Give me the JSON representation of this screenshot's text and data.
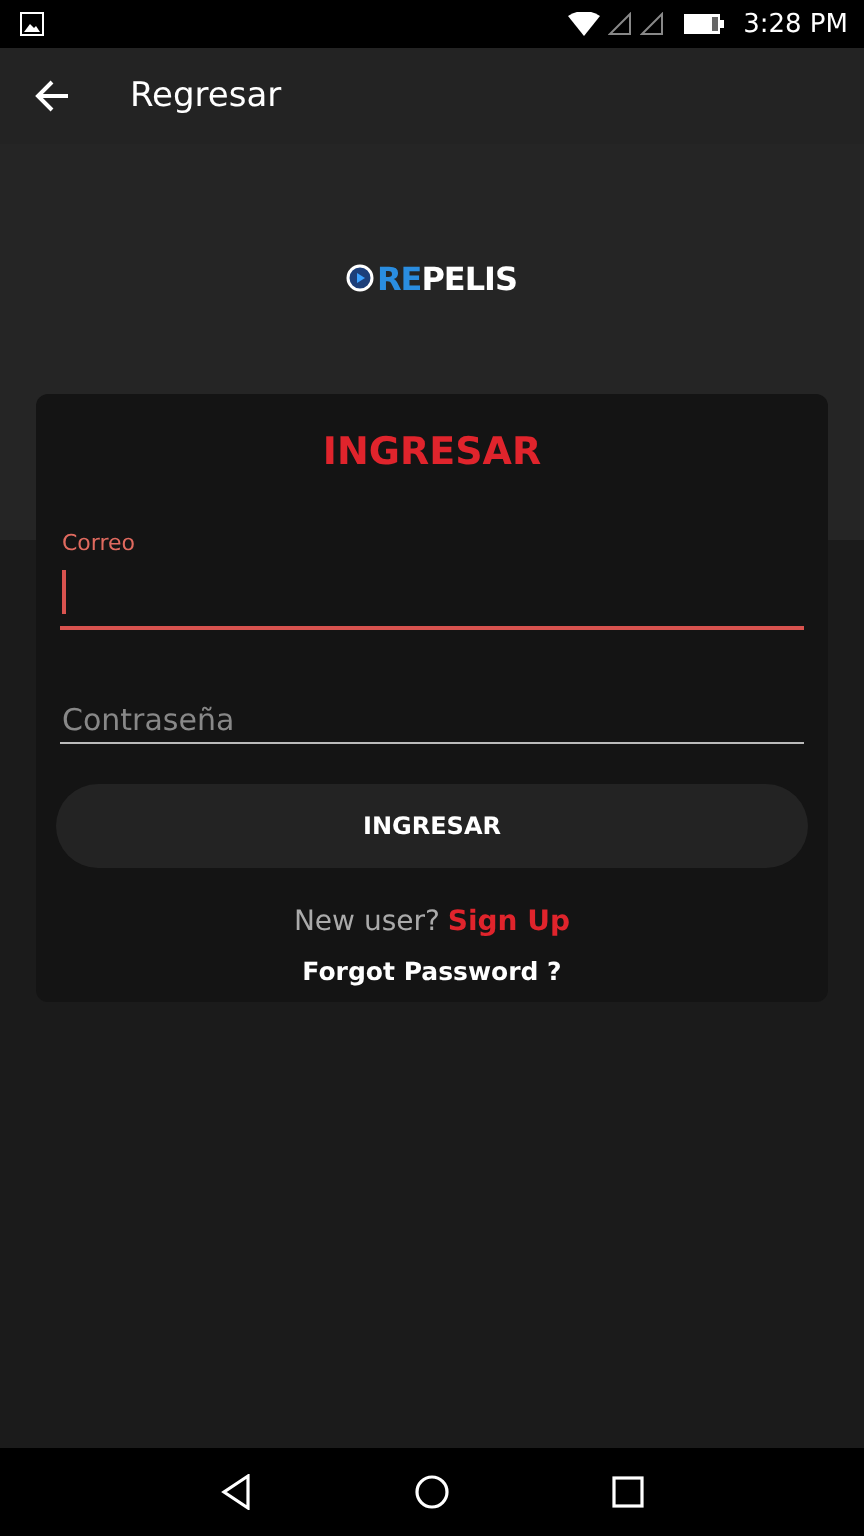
{
  "status_bar": {
    "time": "3:28 PM"
  },
  "app_bar": {
    "title": "Regresar"
  },
  "logo": {
    "highlight": "RE",
    "rest": "PELIS"
  },
  "login_card": {
    "title": "INGRESAR",
    "fields": [
      {
        "label": "Correo",
        "focused": true
      },
      {
        "placeholder": "Contraseña",
        "focused": false
      }
    ],
    "submit": "INGRESAR",
    "signup_prompt": "New user?",
    "signup_link": "Sign Up",
    "forgot_link": "Forgot Password ?"
  }
}
